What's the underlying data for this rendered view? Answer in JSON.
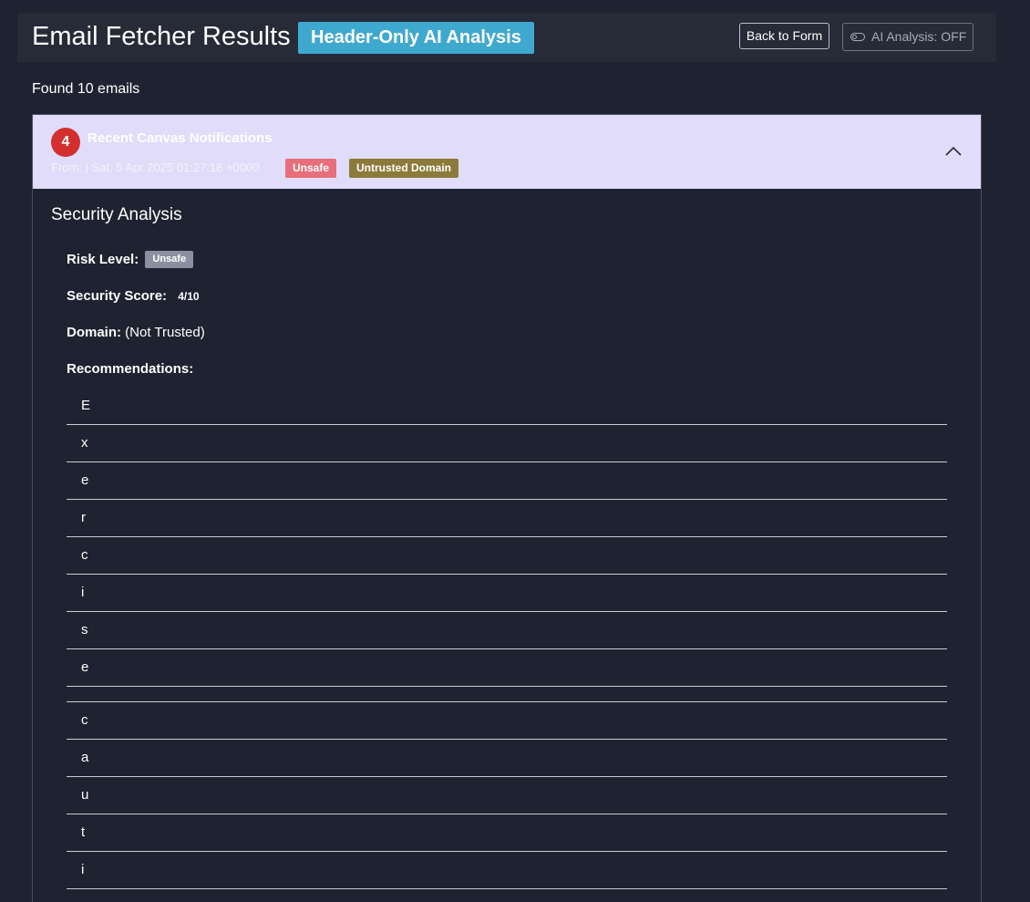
{
  "header": {
    "title": "Email Fetcher Results",
    "mode_badge": "Header-Only AI Analysis",
    "back_button": "Back to Form",
    "ai_toggle": "AI Analysis: OFF"
  },
  "found_count": "Found 10 emails",
  "email": {
    "count_bubble": "4",
    "subject": "Recent Canvas Notifications",
    "meta": "From: | Sat, 5 Apr 2025 01:27:18 +0000",
    "tags": [
      "Unsafe",
      "Untrusted Domain"
    ]
  },
  "analysis": {
    "title": "Security Analysis",
    "risk_label": "Risk Level:",
    "risk_value": "Unsafe",
    "score_label": "Security Score:",
    "score_value": "4/10",
    "domain_label": "Domain:",
    "domain_value": "(Not Trusted)",
    "recommendations_label": "Recommendations:",
    "recommendations": [
      "E",
      "x",
      "e",
      "r",
      "c",
      "i",
      "s",
      "e",
      " ",
      "c",
      "a",
      "u",
      "t",
      "i"
    ]
  },
  "colors": {
    "page_bg": "#1f2230",
    "header_bg": "#272a37",
    "mode_badge": "#3fa8cf",
    "email_header_bg": "#e0dcfa",
    "count_bubble": "#d32f2f",
    "tag_unsafe": "#e76e7a",
    "tag_untrusted": "#8c7a3a",
    "risk_badge": "#8a90a0"
  },
  "icons": {
    "toggle": "toggle-off-icon",
    "collapse": "chevron-up-icon"
  }
}
